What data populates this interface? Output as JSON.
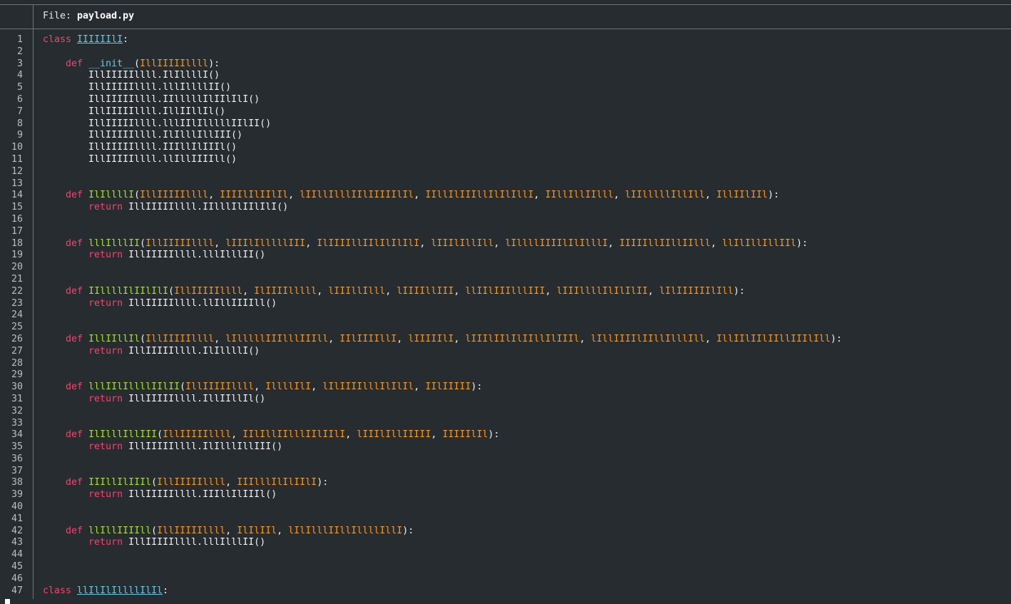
{
  "header": {
    "label": "File: ",
    "filename": "payload.py"
  },
  "colors": {
    "background": "#272c30",
    "keyword": "#f0466f",
    "class_name": "#67c8e6",
    "function_name": "#a6e22e",
    "parameter": "#fd971f",
    "text": "#f2f2f2",
    "line_number": "#b9bec2"
  },
  "lines": [
    {
      "n": "1",
      "tokens": [
        {
          "t": "kw",
          "v": "class "
        },
        {
          "t": "cls",
          "v": "IIIIIIlI"
        },
        {
          "t": "plain",
          "v": ":"
        }
      ]
    },
    {
      "n": "2",
      "tokens": []
    },
    {
      "n": "3",
      "tokens": [
        {
          "t": "plain",
          "v": "    "
        },
        {
          "t": "kw",
          "v": "def "
        },
        {
          "t": "dunder",
          "v": "__init__"
        },
        {
          "t": "plain",
          "v": "("
        },
        {
          "t": "param",
          "v": "IllIIIIIllll"
        },
        {
          "t": "plain",
          "v": "):"
        }
      ]
    },
    {
      "n": "4",
      "tokens": [
        {
          "t": "plain",
          "v": "        IllIIIIIllll.IlIllllI()"
        }
      ]
    },
    {
      "n": "5",
      "tokens": [
        {
          "t": "plain",
          "v": "        IllIIIIIllll.lllIllllII()"
        }
      ]
    },
    {
      "n": "6",
      "tokens": [
        {
          "t": "plain",
          "v": "        IllIIIIIllll.IIlllllIlIIlIlI()"
        }
      ]
    },
    {
      "n": "7",
      "tokens": [
        {
          "t": "plain",
          "v": "        IllIIIIIllll.IllIIllIl()"
        }
      ]
    },
    {
      "n": "8",
      "tokens": [
        {
          "t": "plain",
          "v": "        IllIIIIIllll.lllIIlIlllllIIlII()"
        }
      ]
    },
    {
      "n": "9",
      "tokens": [
        {
          "t": "plain",
          "v": "        IllIIIIIllll.IlIlllIllIII()"
        }
      ]
    },
    {
      "n": "10",
      "tokens": [
        {
          "t": "plain",
          "v": "        IllIIIIIllll.IIIllIlIIIl()"
        }
      ]
    },
    {
      "n": "11",
      "tokens": [
        {
          "t": "plain",
          "v": "        IllIIIIIllll.llIllIIIIll()"
        }
      ]
    },
    {
      "n": "12",
      "tokens": []
    },
    {
      "n": "13",
      "tokens": []
    },
    {
      "n": "14",
      "tokens": [
        {
          "t": "plain",
          "v": "    "
        },
        {
          "t": "kw",
          "v": "def "
        },
        {
          "t": "fn",
          "v": "IlIllllI"
        },
        {
          "t": "plain",
          "v": "("
        },
        {
          "t": "param",
          "v": "IllIIIIIllll"
        },
        {
          "t": "plain",
          "v": ", "
        },
        {
          "t": "param",
          "v": "IIIIlIlIIlIl"
        },
        {
          "t": "plain",
          "v": ", "
        },
        {
          "t": "param",
          "v": "lIIllIlllIIlIIIIIlIl"
        },
        {
          "t": "plain",
          "v": ", "
        },
        {
          "t": "param",
          "v": "IIllIlIIIllIlIlIllI"
        },
        {
          "t": "plain",
          "v": ", "
        },
        {
          "t": "param",
          "v": "IIllIllIIlll"
        },
        {
          "t": "plain",
          "v": ", "
        },
        {
          "t": "param",
          "v": "lIIlllllIllIll"
        },
        {
          "t": "plain",
          "v": ", "
        },
        {
          "t": "param",
          "v": "IllIIlIIl"
        },
        {
          "t": "plain",
          "v": "):"
        }
      ]
    },
    {
      "n": "15",
      "tokens": [
        {
          "t": "plain",
          "v": "        "
        },
        {
          "t": "kw",
          "v": "return "
        },
        {
          "t": "plain",
          "v": "IllIIIIIllll.IIlllIlIIlIlI()"
        }
      ]
    },
    {
      "n": "16",
      "tokens": []
    },
    {
      "n": "17",
      "tokens": []
    },
    {
      "n": "18",
      "tokens": [
        {
          "t": "plain",
          "v": "    "
        },
        {
          "t": "kw",
          "v": "def "
        },
        {
          "t": "fn",
          "v": "lllIlllII"
        },
        {
          "t": "plain",
          "v": "("
        },
        {
          "t": "param",
          "v": "IllIIIIIllll"
        },
        {
          "t": "plain",
          "v": ", "
        },
        {
          "t": "param",
          "v": "lIIIlIlllllIII"
        },
        {
          "t": "plain",
          "v": ", "
        },
        {
          "t": "param",
          "v": "IlIIIIllIIlIlIlIlI"
        },
        {
          "t": "plain",
          "v": ", "
        },
        {
          "t": "param",
          "v": "lIIIlIllIll"
        },
        {
          "t": "plain",
          "v": ", "
        },
        {
          "t": "param",
          "v": "lIllllIIIIlIlIlllI"
        },
        {
          "t": "plain",
          "v": ", "
        },
        {
          "t": "param",
          "v": "IIIIIllIIllIIlll"
        },
        {
          "t": "plain",
          "v": ", "
        },
        {
          "t": "param",
          "v": "llIlIllIllIIl"
        },
        {
          "t": "plain",
          "v": "):"
        }
      ]
    },
    {
      "n": "19",
      "tokens": [
        {
          "t": "plain",
          "v": "        "
        },
        {
          "t": "kw",
          "v": "return "
        },
        {
          "t": "plain",
          "v": "IllIIIIIllll.lllIlllII()"
        }
      ]
    },
    {
      "n": "20",
      "tokens": []
    },
    {
      "n": "21",
      "tokens": []
    },
    {
      "n": "22",
      "tokens": [
        {
          "t": "plain",
          "v": "    "
        },
        {
          "t": "kw",
          "v": "def "
        },
        {
          "t": "fn",
          "v": "IIllllIlIIlIlI"
        },
        {
          "t": "plain",
          "v": "("
        },
        {
          "t": "param",
          "v": "IllIIIIIllll"
        },
        {
          "t": "plain",
          "v": ", "
        },
        {
          "t": "param",
          "v": "IlIIIIlllll"
        },
        {
          "t": "plain",
          "v": ", "
        },
        {
          "t": "param",
          "v": "lIIIllIlll"
        },
        {
          "t": "plain",
          "v": ", "
        },
        {
          "t": "param",
          "v": "lIIIIllIII"
        },
        {
          "t": "plain",
          "v": ", "
        },
        {
          "t": "param",
          "v": "llIIlIIIlllIII"
        },
        {
          "t": "plain",
          "v": ", "
        },
        {
          "t": "param",
          "v": "lIIIllllIlIlIlII"
        },
        {
          "t": "plain",
          "v": ", "
        },
        {
          "t": "param",
          "v": "lIlIIIIIIlIll"
        },
        {
          "t": "plain",
          "v": "):"
        }
      ]
    },
    {
      "n": "23",
      "tokens": [
        {
          "t": "plain",
          "v": "        "
        },
        {
          "t": "kw",
          "v": "return "
        },
        {
          "t": "plain",
          "v": "IllIIIIIllll.llIllIIIIll()"
        }
      ]
    },
    {
      "n": "24",
      "tokens": []
    },
    {
      "n": "25",
      "tokens": []
    },
    {
      "n": "26",
      "tokens": [
        {
          "t": "plain",
          "v": "    "
        },
        {
          "t": "kw",
          "v": "def "
        },
        {
          "t": "fn",
          "v": "IllIIllIl"
        },
        {
          "t": "plain",
          "v": "("
        },
        {
          "t": "param",
          "v": "IllIIIIIllll"
        },
        {
          "t": "plain",
          "v": ", "
        },
        {
          "t": "param",
          "v": "lIlllllIIIlllIIIll"
        },
        {
          "t": "plain",
          "v": ", "
        },
        {
          "t": "param",
          "v": "IIlIIIIllI"
        },
        {
          "t": "plain",
          "v": ", "
        },
        {
          "t": "param",
          "v": "lIIIIIlI"
        },
        {
          "t": "plain",
          "v": ", "
        },
        {
          "t": "param",
          "v": "lIIIlIIlIlIIllIlIIIl"
        },
        {
          "t": "plain",
          "v": ", "
        },
        {
          "t": "param",
          "v": "lIllIIIIlIIllIlllIll"
        },
        {
          "t": "plain",
          "v": ", "
        },
        {
          "t": "param",
          "v": "IllIIlIIlIIllIIIlIll"
        },
        {
          "t": "plain",
          "v": "):"
        }
      ]
    },
    {
      "n": "27",
      "tokens": [
        {
          "t": "plain",
          "v": "        "
        },
        {
          "t": "kw",
          "v": "return "
        },
        {
          "t": "plain",
          "v": "IllIIIIIllll.IlIllllI()"
        }
      ]
    },
    {
      "n": "28",
      "tokens": []
    },
    {
      "n": "29",
      "tokens": []
    },
    {
      "n": "30",
      "tokens": [
        {
          "t": "plain",
          "v": "    "
        },
        {
          "t": "kw",
          "v": "def "
        },
        {
          "t": "fn",
          "v": "lllIIlIllllIIlII"
        },
        {
          "t": "plain",
          "v": "("
        },
        {
          "t": "param",
          "v": "IllIIIIIllll"
        },
        {
          "t": "plain",
          "v": ", "
        },
        {
          "t": "param",
          "v": "IllllIlI"
        },
        {
          "t": "plain",
          "v": ", "
        },
        {
          "t": "param",
          "v": "lIlIIIIlllIlIlIl"
        },
        {
          "t": "plain",
          "v": ", "
        },
        {
          "t": "param",
          "v": "IIlIIIII"
        },
        {
          "t": "plain",
          "v": "):"
        }
      ]
    },
    {
      "n": "31",
      "tokens": [
        {
          "t": "plain",
          "v": "        "
        },
        {
          "t": "kw",
          "v": "return "
        },
        {
          "t": "plain",
          "v": "IllIIIIIllll.IllIIllIl()"
        }
      ]
    },
    {
      "n": "32",
      "tokens": []
    },
    {
      "n": "33",
      "tokens": []
    },
    {
      "n": "34",
      "tokens": [
        {
          "t": "plain",
          "v": "    "
        },
        {
          "t": "kw",
          "v": "def "
        },
        {
          "t": "fn",
          "v": "IlIlllIllIII"
        },
        {
          "t": "plain",
          "v": "("
        },
        {
          "t": "param",
          "v": "IllIIIIIllll"
        },
        {
          "t": "plain",
          "v": ", "
        },
        {
          "t": "param",
          "v": "IIlIllIIlllIIlIIlI"
        },
        {
          "t": "plain",
          "v": ", "
        },
        {
          "t": "param",
          "v": "lIIIlIllIIIII"
        },
        {
          "t": "plain",
          "v": ", "
        },
        {
          "t": "param",
          "v": "IIIIIlIl"
        },
        {
          "t": "plain",
          "v": "):"
        }
      ]
    },
    {
      "n": "35",
      "tokens": [
        {
          "t": "plain",
          "v": "        "
        },
        {
          "t": "kw",
          "v": "return "
        },
        {
          "t": "plain",
          "v": "IllIIIIIllll.IlIlllIllIII()"
        }
      ]
    },
    {
      "n": "36",
      "tokens": []
    },
    {
      "n": "37",
      "tokens": []
    },
    {
      "n": "38",
      "tokens": [
        {
          "t": "plain",
          "v": "    "
        },
        {
          "t": "kw",
          "v": "def "
        },
        {
          "t": "fn",
          "v": "IIIllIlIIIl"
        },
        {
          "t": "plain",
          "v": "("
        },
        {
          "t": "param",
          "v": "IllIIIIIllll"
        },
        {
          "t": "plain",
          "v": ", "
        },
        {
          "t": "param",
          "v": "IIIlllIlIlIIlI"
        },
        {
          "t": "plain",
          "v": "):"
        }
      ]
    },
    {
      "n": "39",
      "tokens": [
        {
          "t": "plain",
          "v": "        "
        },
        {
          "t": "kw",
          "v": "return "
        },
        {
          "t": "plain",
          "v": "IllIIIIIllll.IIIllIlIIIl()"
        }
      ]
    },
    {
      "n": "40",
      "tokens": []
    },
    {
      "n": "41",
      "tokens": []
    },
    {
      "n": "42",
      "tokens": [
        {
          "t": "plain",
          "v": "    "
        },
        {
          "t": "kw",
          "v": "def "
        },
        {
          "t": "fn",
          "v": "llIllIIIIll"
        },
        {
          "t": "plain",
          "v": "("
        },
        {
          "t": "param",
          "v": "IllIIIIIllll"
        },
        {
          "t": "plain",
          "v": ", "
        },
        {
          "t": "param",
          "v": "IlIlIIl"
        },
        {
          "t": "plain",
          "v": ", "
        },
        {
          "t": "param",
          "v": "lIlIlllIIllIllllIllI"
        },
        {
          "t": "plain",
          "v": "):"
        }
      ]
    },
    {
      "n": "43",
      "tokens": [
        {
          "t": "plain",
          "v": "        "
        },
        {
          "t": "kw",
          "v": "return "
        },
        {
          "t": "plain",
          "v": "IllIIIIIllll.lllIlllII()"
        }
      ]
    },
    {
      "n": "44",
      "tokens": []
    },
    {
      "n": "45",
      "tokens": []
    },
    {
      "n": "46",
      "tokens": []
    },
    {
      "n": "47",
      "tokens": [
        {
          "t": "kw",
          "v": "class "
        },
        {
          "t": "cls",
          "v": "llIlIlIllllIlIl"
        },
        {
          "t": "plain",
          "v": ":"
        }
      ]
    }
  ]
}
